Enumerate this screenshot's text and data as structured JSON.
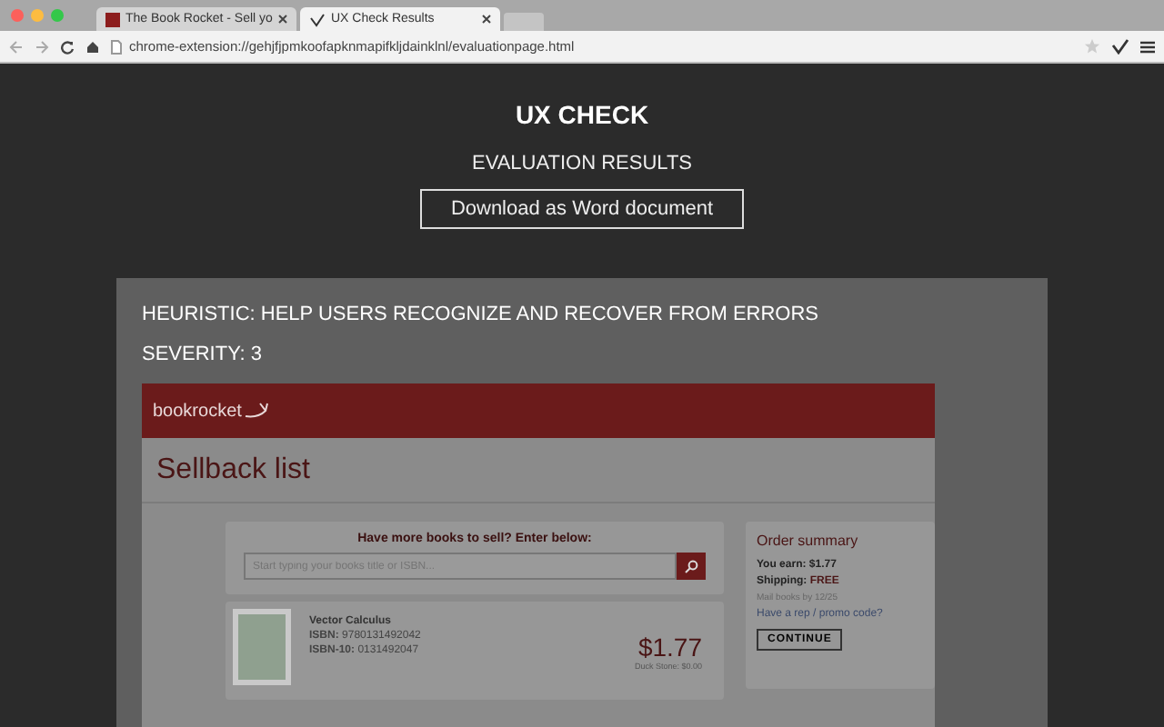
{
  "browser": {
    "tabs": [
      {
        "title": "The Book Rocket - Sell yo",
        "selected": false
      },
      {
        "title": "UX Check Results",
        "selected": true
      }
    ],
    "url": "chrome-extension://gehjfjpmkoofapknmapifkljdainklnl/evaluationpage.html"
  },
  "header": {
    "title": "UX CHECK",
    "subtitle": "EVALUATION RESULTS",
    "download_button": "Download as Word document"
  },
  "finding": {
    "heuristic": "HEURISTIC: HELP USERS RECOGNIZE AND RECOVER FROM ERRORS",
    "severity": "SEVERITY: 3"
  },
  "screenshot": {
    "logo": "bookrocket",
    "page_title": "Sellback list",
    "search_prompt": "Have more books to sell? Enter below:",
    "search_placeholder": "Start typing your books title or ISBN...",
    "book": {
      "title": "Vector Calculus",
      "isbn_label": "ISBN:",
      "isbn": "9780131492042",
      "isbn10_label": "ISBN-10:",
      "isbn10": "0131492047",
      "price": "$1.77",
      "note": "Duck Stone: $0.00"
    },
    "order_summary": {
      "title": "Order summary",
      "earn_label": "You earn:",
      "earn": "$1.77",
      "shipping_label": "Shipping:",
      "shipping": "FREE",
      "mail_note": "Mail books by 12/25",
      "promo_link": "Have a rep / promo code?",
      "continue_button": "CONTINUE"
    }
  }
}
